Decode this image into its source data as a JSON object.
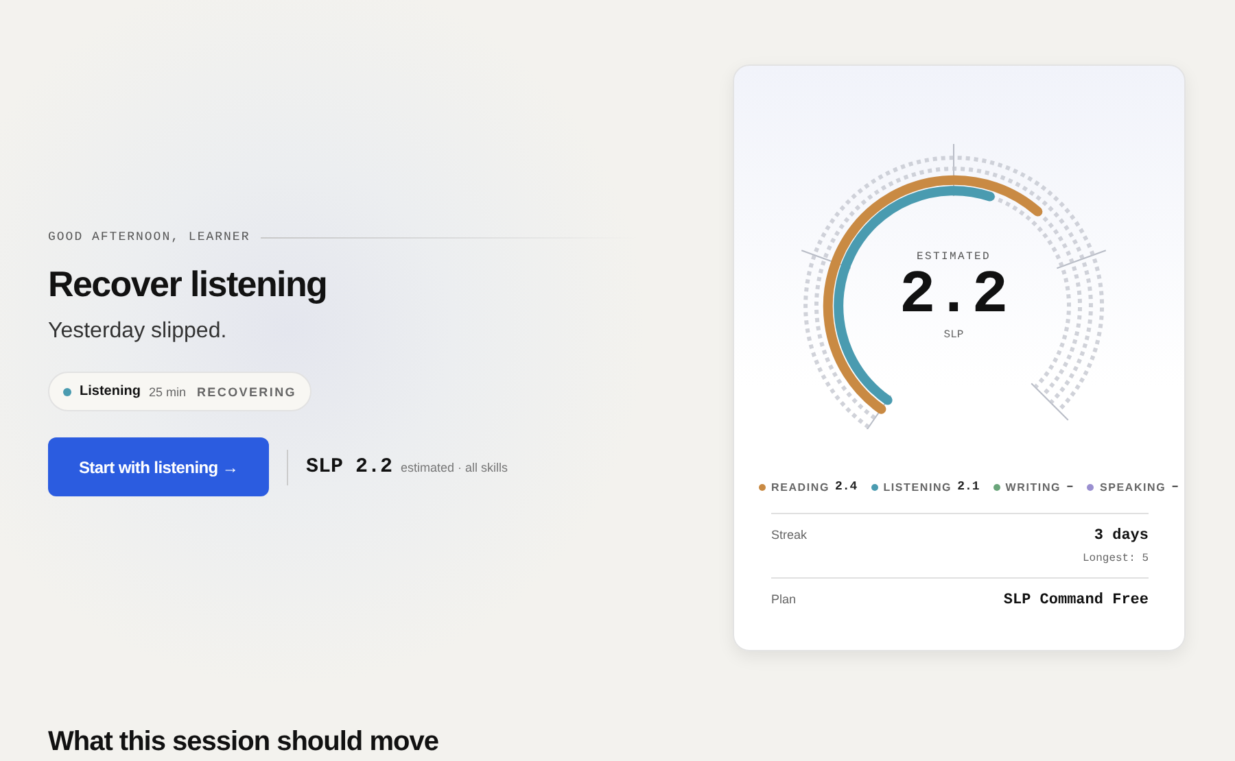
{
  "hero": {
    "eyebrow": "GOOD AFTERNOON, LEARNER",
    "title": "Recover listening",
    "subtitle": "Yesterday slipped.",
    "focus_pill": {
      "skill": "Listening",
      "color": "#4a9bb0",
      "duration": "25 min",
      "status": "RECOVERING"
    },
    "primary_button": "Start with listening →",
    "score": {
      "label": "SLP 2.2",
      "note": "estimated · all skills"
    }
  },
  "card": {
    "gauge": {
      "caption": "ESTIMATED",
      "value": "2.2",
      "unit": "SLP"
    },
    "skills": [
      {
        "name": "READING",
        "value": "2.4",
        "color": "#c98a43"
      },
      {
        "name": "LISTENING",
        "value": "2.1",
        "color": "#4a9bb0"
      },
      {
        "name": "WRITING",
        "value": "–",
        "color": "#6aa57a"
      },
      {
        "name": "SPEAKING",
        "value": "–",
        "color": "#9a8fd0"
      }
    ],
    "rows": [
      {
        "label": "Streak",
        "value": "3 days",
        "detail": "Longest: 5"
      },
      {
        "label": "Plan",
        "value": "SLP Command Free"
      }
    ]
  },
  "section": {
    "title": "What this session should move"
  }
}
